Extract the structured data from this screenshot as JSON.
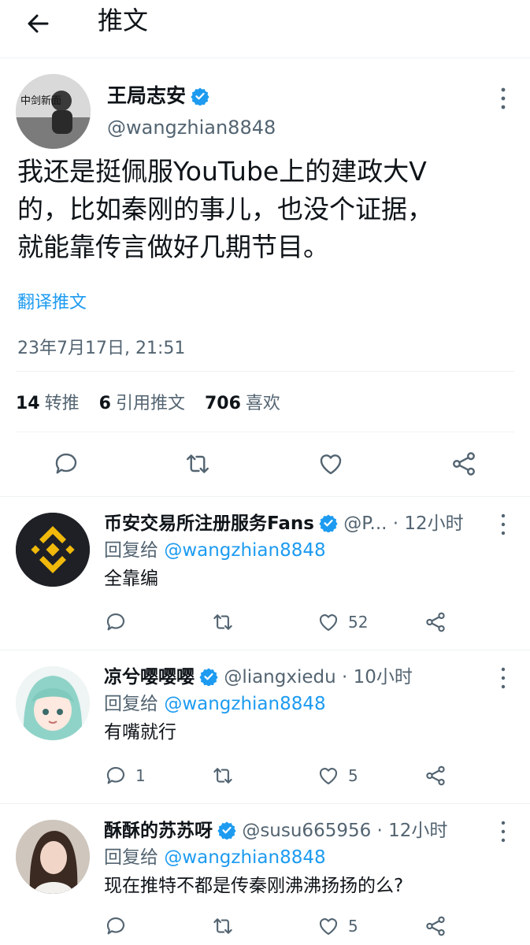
{
  "header": {
    "title": "推文"
  },
  "tweet": {
    "author_name": "王局志安",
    "author_handle": "@wangzhian8848",
    "text_line1": "我还是挺佩服YouTube上的建政大V",
    "text_line2": "的，比如秦刚的事儿，也没个证据，",
    "text_line3": "就能靠传言做好几期节目。",
    "translate_label": "翻译推文",
    "timestamp": "23年7月17日, 21:51",
    "retweets": "14",
    "retweets_label": "转推",
    "quotes": "6",
    "quotes_label": "引用推文",
    "likes": "706",
    "likes_label": "喜欢",
    "avatar_text": "中剑新面"
  },
  "replies": [
    {
      "name": "币安交易所注册服务Fans",
      "meta": "@P... · 12小时",
      "reply_label": "回复给 ",
      "reply_to": "@wangzhian8848",
      "text": "全靠编",
      "reply_count": "",
      "retweet_count": "",
      "like_count": "52"
    },
    {
      "name": "凉兮嘤嘤嘤",
      "meta": "@liangxiedu · 10小时",
      "reply_label": "回复给 ",
      "reply_to": "@wangzhian8848",
      "text": "有嘴就行",
      "reply_count": "1",
      "retweet_count": "",
      "like_count": "5"
    },
    {
      "name": "酥酥的苏苏呀",
      "meta": "@susu665956 · 12小时",
      "reply_label": "回复给 ",
      "reply_to": "@wangzhian8848",
      "text": "现在推特不都是传秦刚沸沸扬扬的么?",
      "reply_count": "",
      "retweet_count": "",
      "like_count": "5"
    }
  ],
  "colors": {
    "accent": "#1d9bf0",
    "secondary": "#536471",
    "binance": "#f0b90b"
  },
  "icons": [
    "back-arrow-icon",
    "verified-badge-icon",
    "more-icon",
    "reply-icon",
    "retweet-icon",
    "like-icon",
    "share-icon"
  ]
}
